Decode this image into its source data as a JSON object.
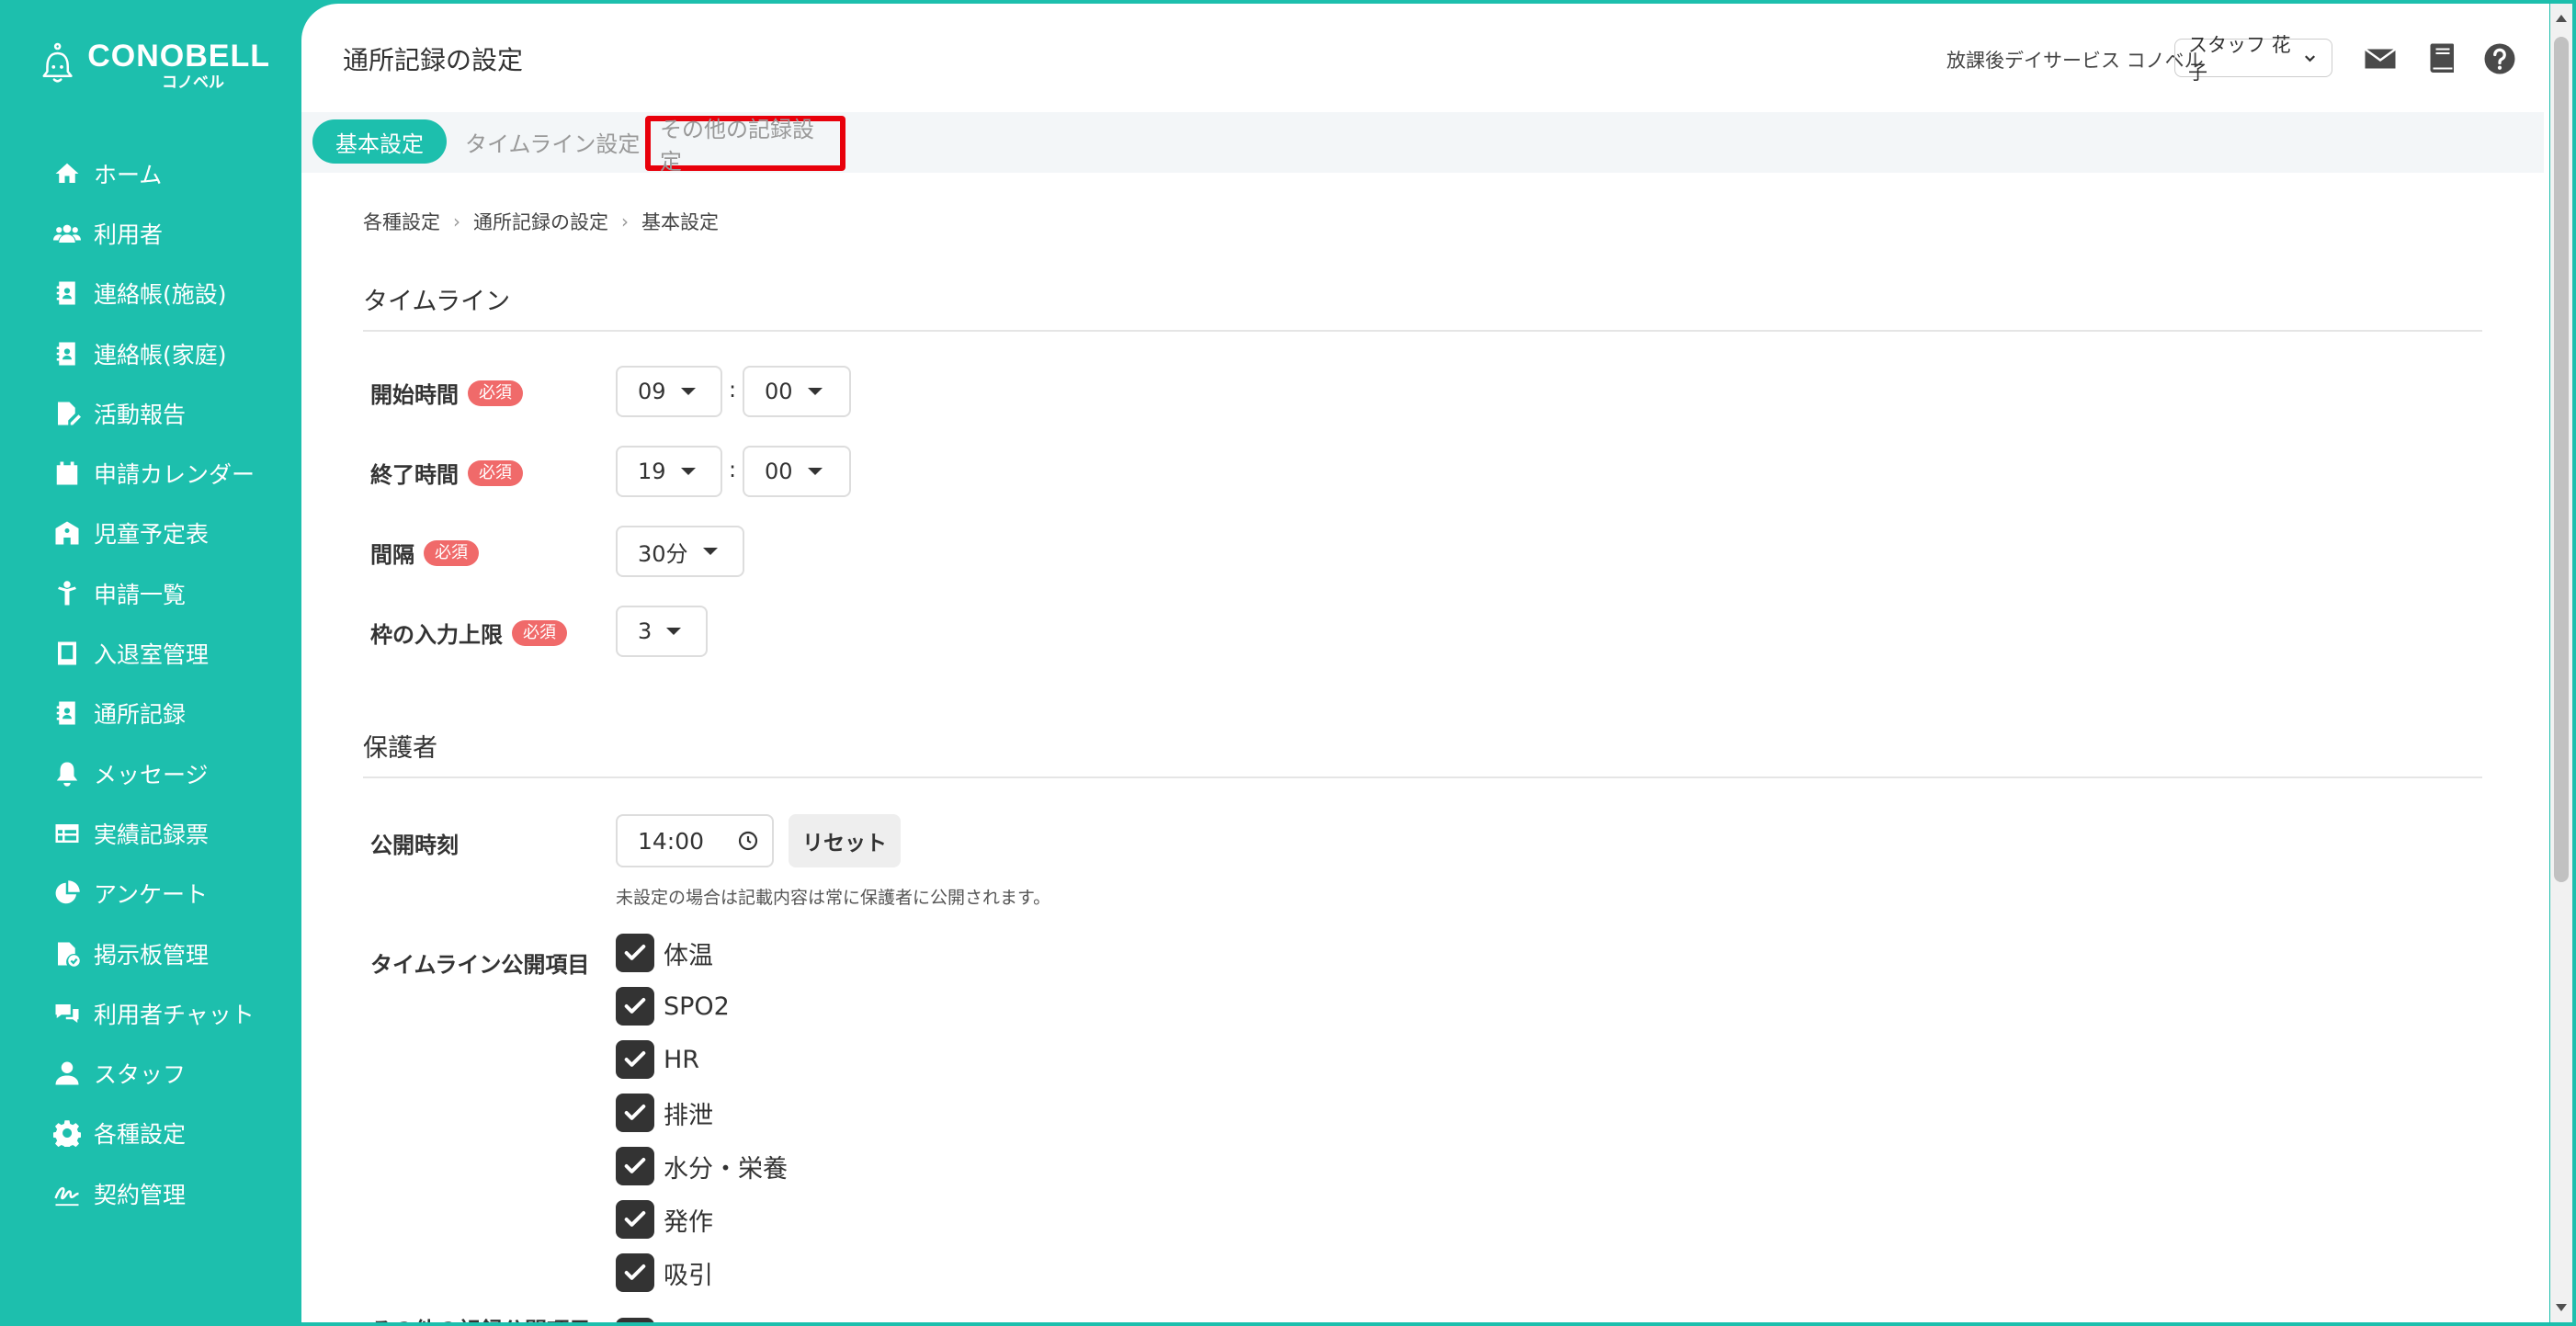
{
  "brand": {
    "logo_text": "CONOBELL",
    "logo_sub": "コノベル"
  },
  "sidebar": {
    "items": [
      {
        "label": "ホーム",
        "icon": "home-icon"
      },
      {
        "label": "利用者",
        "icon": "users-icon"
      },
      {
        "label": "連絡帳(施設)",
        "icon": "contact-book-icon"
      },
      {
        "label": "連絡帳(家庭)",
        "icon": "contact-book-icon"
      },
      {
        "label": "活動報告",
        "icon": "file-edit-icon"
      },
      {
        "label": "申請カレンダー",
        "icon": "calendar-icon"
      },
      {
        "label": "児童予定表",
        "icon": "school-icon"
      },
      {
        "label": "申請一覧",
        "icon": "child-icon"
      },
      {
        "label": "入退室管理",
        "icon": "tablet-icon"
      },
      {
        "label": "通所記録",
        "icon": "id-card-icon"
      },
      {
        "label": "メッセージ",
        "icon": "bell-icon"
      },
      {
        "label": "実績記録票",
        "icon": "table-icon"
      },
      {
        "label": "アンケート",
        "icon": "pie-chart-icon"
      },
      {
        "label": "掲示板管理",
        "icon": "file-check-icon"
      },
      {
        "label": "利用者チャット",
        "icon": "chat-icon"
      },
      {
        "label": "スタッフ",
        "icon": "staff-icon"
      },
      {
        "label": "各種設定",
        "icon": "gear-icon"
      },
      {
        "label": "契約管理",
        "icon": "signature-icon"
      }
    ]
  },
  "header": {
    "title": "通所記録の設定",
    "org_name": "放課後デイサービス コノベル",
    "staff_name": "スタッフ 花子"
  },
  "tabs": [
    {
      "label": "基本設定",
      "active": true
    },
    {
      "label": "タイムライン設定",
      "active": false
    },
    {
      "label": "その他の記録設定",
      "active": false
    }
  ],
  "breadcrumb": [
    "各種設定",
    "通所記録の設定",
    "基本設定"
  ],
  "timeline": {
    "section_title": "タイムライン",
    "required_label": "必須",
    "start": {
      "label": "開始時間",
      "hour": "09",
      "minute": "00"
    },
    "end": {
      "label": "終了時間",
      "hour": "19",
      "minute": "00"
    },
    "interval": {
      "label": "間隔",
      "value": "30分"
    },
    "limit": {
      "label": "枠の入力上限",
      "value": "3"
    }
  },
  "guardian": {
    "section_title": "保護者",
    "publish_time": {
      "label": "公開時刻",
      "value": "14:00",
      "reset_label": "リセット"
    },
    "hint": "未設定の場合は記載内容は常に保護者に公開されます。",
    "timeline_items_label": "タイムライン公開項目",
    "items": [
      "体温",
      "SPO2",
      "HR",
      "排泄",
      "水分・栄養",
      "発作",
      "吸引"
    ],
    "next_label_partial": "その他の記録公開項目"
  },
  "colors": {
    "brand": "#1dbfad",
    "required": "#f06a6a",
    "highlight": "#e8000b"
  }
}
